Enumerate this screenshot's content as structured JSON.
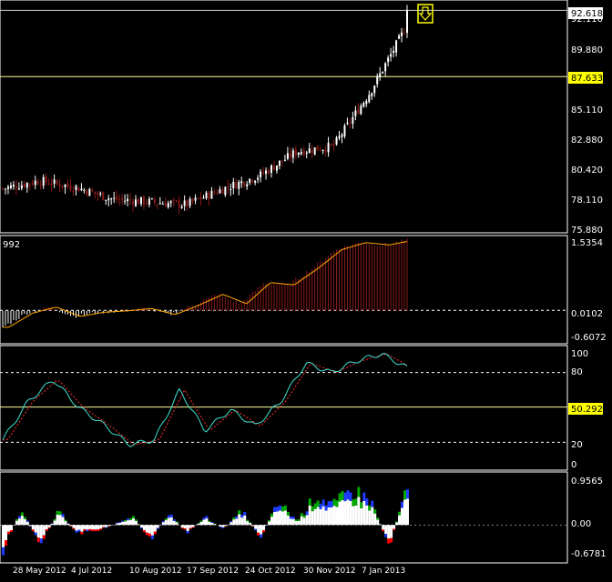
{
  "colors": {
    "background": "#000000",
    "frame": "#ffffff",
    "bull": "#ffffff",
    "bear": "#8b1a1a",
    "level_line": "#ffff99",
    "level_label_bg": "#ffff00",
    "current_label_bg": "#ffffff",
    "hist_up": "#8b1a1a",
    "hist_down": "#ffffff",
    "signal_line": "#ffa500",
    "signal_line_alt": "#3cb371",
    "stoch_main": "#40e0d0",
    "stoch_signal": "#ff3030",
    "osc_white": "#ffffff",
    "osc_red": "#ff0000",
    "osc_blue": "#1e3cff",
    "osc_green": "#00aa00",
    "sell_arrow": "#ffff00"
  },
  "price_panel": {
    "ticks": [
      "92.110",
      "89.880",
      "87.650",
      "85.110",
      "82.880",
      "80.420",
      "78.110",
      "75.880"
    ],
    "current_price": "92.618",
    "level_price": "87.633",
    "sell_arrow_icon": "down-arrow-icon",
    "chart_data": {
      "type": "line",
      "title": "",
      "ylim": [
        75.88,
        93.4
      ],
      "x": [
        "28 May 2012",
        "4 Jul 2012",
        "10 Aug 2012",
        "17 Sep 2012",
        "24 Oct 2012",
        "30 Nov 2012",
        "7 Jan 2013"
      ],
      "series": [
        {
          "name": "",
          "values": [
            79.2,
            79.8,
            79.3,
            78.4,
            78.2,
            78.0,
            79.2,
            80.2,
            82.0,
            82.4,
            86.5,
            91.5
          ]
        }
      ],
      "level": 87.633,
      "last": 92.618
    }
  },
  "macd_panel": {
    "label": "992",
    "ticks": [
      "1.5354",
      "0.0102",
      "-0.6072"
    ],
    "chart_data": {
      "type": "bar",
      "ylim": [
        -0.7,
        1.6
      ],
      "values_start": -0.15,
      "values_end": 1.45
    }
  },
  "stoch_panel": {
    "ticks": [
      "100",
      "80",
      "50.292",
      "20",
      "0"
    ],
    "chart_data": {
      "type": "line",
      "ylim": [
        0,
        100
      ],
      "levels": [
        80,
        50.292,
        20
      ],
      "series": [
        {
          "name": "",
          "values": [
            22,
            55,
            74,
            50,
            35,
            18,
            22,
            65,
            30,
            48,
            34,
            55,
            88,
            80,
            90,
            96,
            84
          ]
        }
      ]
    }
  },
  "osc_panel": {
    "ticks": [
      "0.9565",
      "0.00",
      "-0.6781"
    ],
    "chart_data": {
      "type": "bar",
      "ylim": [
        -0.7,
        1.0
      ]
    }
  },
  "date_axis": [
    "28 May 2012",
    "4 Jul 2012",
    "10 Aug 2012",
    "17 Sep 2012",
    "24 Oct 2012",
    "30 Nov 2012",
    "7 Jan 2013"
  ]
}
